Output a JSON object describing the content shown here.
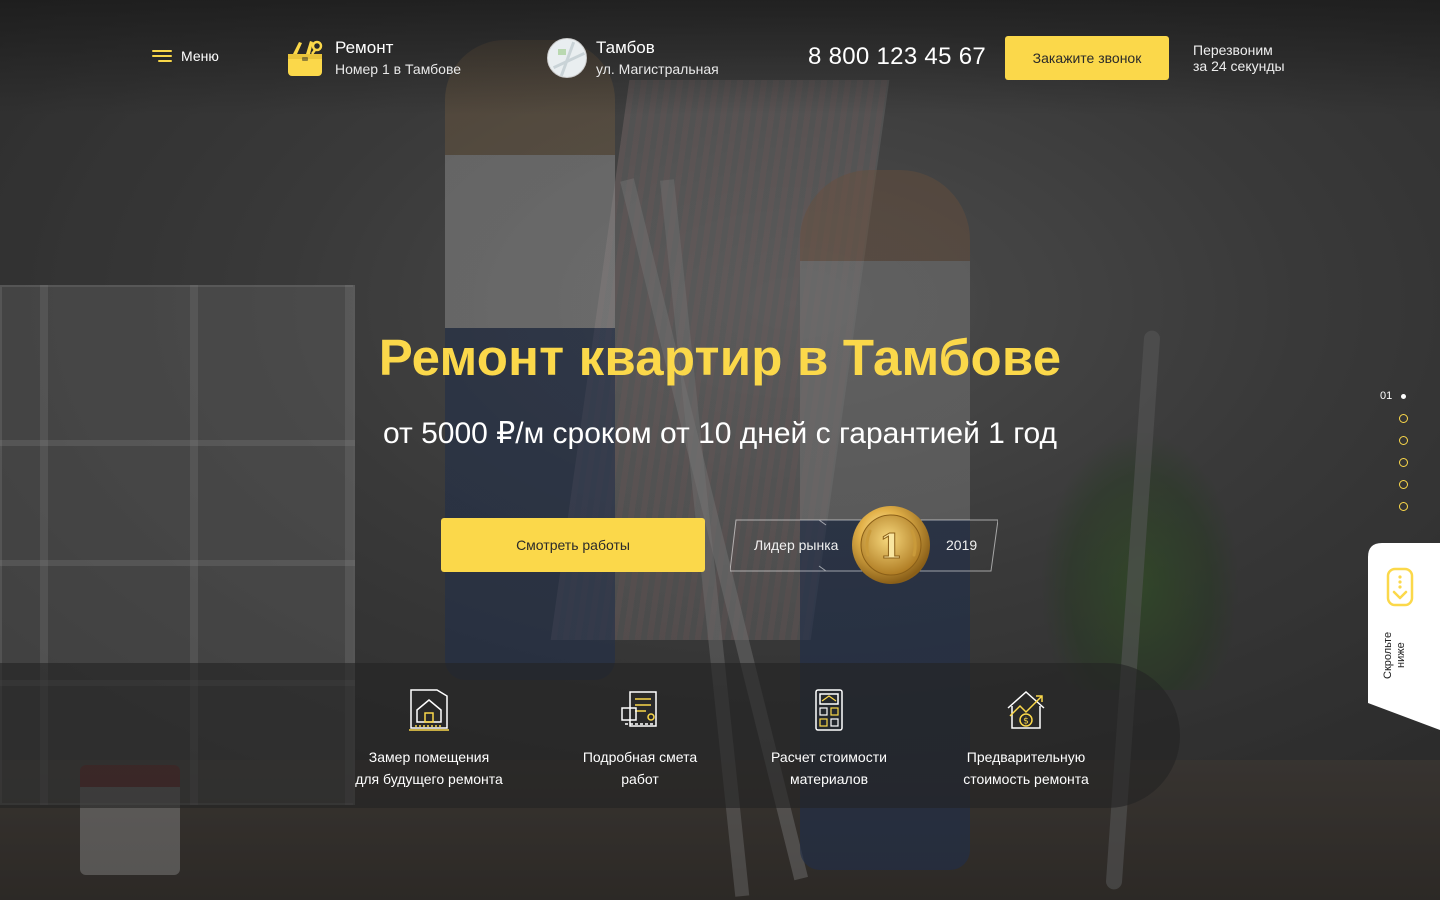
{
  "header": {
    "menu_label": "Меню",
    "brand": {
      "title": "Ремонт",
      "subtitle": "Номер 1 в Тамбове"
    },
    "city": {
      "title": "Тамбов",
      "subtitle": "ул. Магистральная"
    },
    "phone": "8 800 123 45 67",
    "call_button": "Закажите звонок",
    "callback_line1": "Перезвоним",
    "callback_line2": "за 24 секунды"
  },
  "hero": {
    "title": "Ремонт квартир в Тамбове",
    "subtitle": "от 5000 ₽/м сроком от 10 дней с гарантией 1 год",
    "works_button": "Смотреть работы",
    "award": {
      "label": "Лидер рынка",
      "place": "1",
      "year": "2019"
    }
  },
  "pager": {
    "current": "01",
    "total_slides": 6
  },
  "scroll_hint": {
    "line1": "Скрольте",
    "line2": "ниже"
  },
  "features": [
    {
      "icon": "house-measure-icon",
      "line1": "Замер помещения",
      "line2": "для будущего ремонта"
    },
    {
      "icon": "estimate-document-icon",
      "line1": "Подробная смета",
      "line2": "работ"
    },
    {
      "icon": "calculator-icon",
      "line1": "Расчет стоимости",
      "line2": "материалов"
    },
    {
      "icon": "house-price-icon",
      "line1": "Предварительную",
      "line2": "стоимость ремонта"
    }
  ],
  "colors": {
    "accent": "#fbd84a",
    "overlay": "#232323",
    "text": "#ffffff"
  }
}
